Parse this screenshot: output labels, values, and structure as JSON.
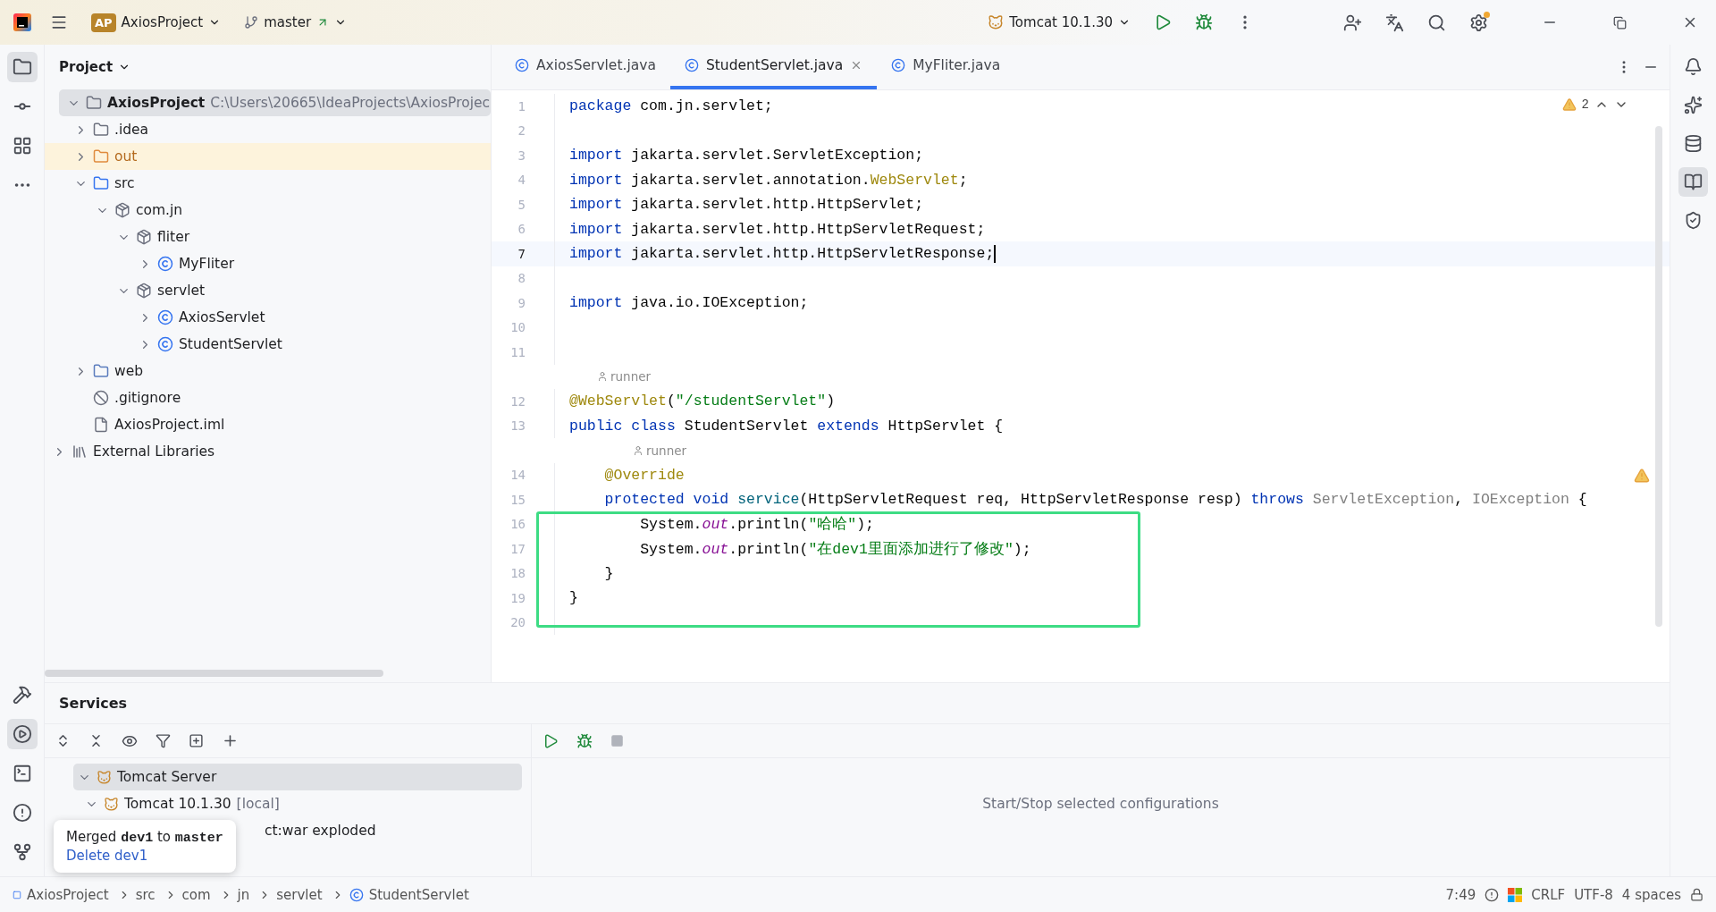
{
  "title_bar": {
    "project_badge": "AP",
    "project": "AxiosProject",
    "branch": "master",
    "run_config": "Tomcat 10.1.30"
  },
  "project_panel": {
    "title": "Project",
    "tree": [
      {
        "label": "AxiosProject",
        "kind": "project",
        "path": "C:\\Users\\20665\\IdeaProjects\\AxiosProjec",
        "expanded": true,
        "selected": true,
        "children": [
          {
            "label": ".idea",
            "kind": "folder",
            "expanded": false,
            "selected": false
          },
          {
            "label": "out",
            "kind": "excluded",
            "expanded": false,
            "selected": false
          },
          {
            "label": "src",
            "kind": "source",
            "expanded": true,
            "selected": false,
            "children": [
              {
                "label": "com.jn",
                "kind": "package",
                "expanded": true,
                "selected": false,
                "children": [
                  {
                    "label": "fliter",
                    "kind": "package",
                    "expanded": true,
                    "selected": false,
                    "children": [
                      {
                        "label": "MyFliter",
                        "kind": "class",
                        "expanded": false,
                        "selected": false
                      }
                    ]
                  },
                  {
                    "label": "servlet",
                    "kind": "package",
                    "expanded": true,
                    "selected": false,
                    "children": [
                      {
                        "label": "AxiosServlet",
                        "kind": "class",
                        "expanded": false,
                        "selected": false
                      },
                      {
                        "label": "StudentServlet",
                        "kind": "class",
                        "expanded": false,
                        "selected": false
                      }
                    ]
                  }
                ]
              }
            ]
          },
          {
            "label": "web",
            "kind": "web",
            "expanded": false,
            "selected": false
          },
          {
            "label": ".gitignore",
            "kind": "ignore",
            "selected": false
          },
          {
            "label": "AxiosProject.iml",
            "kind": "file",
            "selected": false
          }
        ]
      },
      {
        "label": "External Libraries",
        "kind": "library",
        "expanded": false,
        "selected": false
      }
    ]
  },
  "editor": {
    "tabs": [
      {
        "label": "AxiosServlet.java",
        "selected": false
      },
      {
        "label": "StudentServlet.java",
        "selected": true
      },
      {
        "label": "MyFliter.java",
        "selected": false
      }
    ],
    "warnings": "2",
    "lines": [
      {
        "kind": "code",
        "number": "1",
        "current": false,
        "tokens": [
          {
            "kind": "kw",
            "text": "package "
          },
          {
            "kind": "plain",
            "text": "com.jn.servlet;"
          }
        ]
      },
      {
        "kind": "code",
        "number": "2",
        "current": false
      },
      {
        "kind": "code",
        "number": "3",
        "current": false,
        "tokens": [
          {
            "kind": "kw",
            "text": "import "
          },
          {
            "kind": "plain",
            "text": "jakarta.servlet.ServletException;"
          }
        ]
      },
      {
        "kind": "code",
        "number": "4",
        "current": false,
        "tokens": [
          {
            "kind": "kw",
            "text": "import "
          },
          {
            "kind": "plain",
            "text": "jakarta.servlet.annotation."
          },
          {
            "kind": "ann",
            "text": "WebServlet"
          },
          {
            "kind": "plain",
            "text": ";"
          }
        ]
      },
      {
        "kind": "code",
        "number": "5",
        "current": false,
        "tokens": [
          {
            "kind": "kw",
            "text": "import "
          },
          {
            "kind": "plain",
            "text": "jakarta.servlet.http.HttpServlet;"
          }
        ]
      },
      {
        "kind": "code",
        "number": "6",
        "current": false,
        "tokens": [
          {
            "kind": "kw",
            "text": "import "
          },
          {
            "kind": "plain",
            "text": "jakarta.servlet.http.HttpServletRequest;"
          }
        ]
      },
      {
        "kind": "code",
        "number": "7",
        "current": true,
        "tokens": [
          {
            "kind": "kw",
            "text": "import "
          },
          {
            "kind": "plain",
            "text": "jakarta.servlet.http.HttpServletResponse;"
          }
        ]
      },
      {
        "kind": "code",
        "number": "8",
        "current": false
      },
      {
        "kind": "code",
        "number": "9",
        "current": false,
        "tokens": [
          {
            "kind": "kw",
            "text": "import "
          },
          {
            "kind": "plain",
            "text": "java.io.IOException;"
          }
        ]
      },
      {
        "kind": "code",
        "number": "10",
        "current": false
      },
      {
        "kind": "code",
        "number": "11",
        "current": false
      },
      {
        "kind": "hint",
        "text": "runner",
        "nested": false
      },
      {
        "kind": "code",
        "number": "12",
        "current": false,
        "tokens": [
          {
            "kind": "ann",
            "text": "@WebServlet"
          },
          {
            "kind": "plain",
            "text": "("
          },
          {
            "kind": "str",
            "text": "\"/studentServlet\""
          },
          {
            "kind": "plain",
            "text": ")"
          }
        ]
      },
      {
        "kind": "code",
        "number": "13",
        "current": false,
        "tokens": [
          {
            "kind": "kw",
            "text": "public class "
          },
          {
            "kind": "plain",
            "text": "StudentServlet "
          },
          {
            "kind": "kw",
            "text": "extends "
          },
          {
            "kind": "plain",
            "text": "HttpServlet {"
          }
        ]
      },
      {
        "kind": "hint",
        "text": "runner",
        "nested": true
      },
      {
        "kind": "code",
        "number": "14",
        "current": false,
        "tokens": [
          {
            "kind": "ann",
            "text": "    @Override"
          }
        ]
      },
      {
        "kind": "code",
        "number": "15",
        "current": false,
        "tokens": [
          {
            "kind": "kw",
            "text": "    protected void "
          },
          {
            "kind": "method",
            "text": "service"
          },
          {
            "kind": "plain",
            "text": "(HttpServletRequest req, HttpServletResponse resp) "
          },
          {
            "kind": "kw",
            "text": "throws "
          },
          {
            "kind": "muted",
            "text": "ServletException"
          },
          {
            "kind": "plain",
            "text": ", "
          },
          {
            "kind": "muted",
            "text": "IOException"
          },
          {
            "kind": "plain",
            "text": " {"
          }
        ]
      },
      {
        "kind": "code",
        "number": "16",
        "current": false,
        "tokens": [
          {
            "kind": "plain",
            "text": "        System."
          },
          {
            "kind": "static",
            "text": "out"
          },
          {
            "kind": "plain",
            "text": ".println("
          },
          {
            "kind": "str",
            "text": "\"哈哈\""
          },
          {
            "kind": "plain",
            "text": ");"
          }
        ]
      },
      {
        "kind": "code",
        "number": "17",
        "current": false,
        "tokens": [
          {
            "kind": "plain",
            "text": "        System."
          },
          {
            "kind": "static",
            "text": "out"
          },
          {
            "kind": "plain",
            "text": ".println("
          },
          {
            "kind": "str",
            "text": "\"在dev1里面添加进行了修改\""
          },
          {
            "kind": "plain",
            "text": ");"
          }
        ]
      },
      {
        "kind": "code",
        "number": "18",
        "current": false,
        "tokens": [
          {
            "kind": "plain",
            "text": "    }"
          }
        ]
      },
      {
        "kind": "code",
        "number": "19",
        "current": false,
        "tokens": [
          {
            "kind": "plain",
            "text": "}"
          }
        ]
      },
      {
        "kind": "code",
        "number": "20",
        "current": false
      }
    ]
  },
  "services": {
    "title": "Services",
    "tree": [
      {
        "label": "Tomcat Server",
        "expanded": true,
        "selected": true,
        "children": [
          {
            "label": "Tomcat 10.1.30",
            "suffix": "[local]",
            "expanded": true,
            "selected": false,
            "children": [
              {
                "label": "ct:war exploded",
                "selected": false
              }
            ]
          }
        ]
      }
    ],
    "hint": "Start/Stop selected configurations"
  },
  "notification": {
    "text": "Merged **dev1** to **master**",
    "link": "Delete dev1"
  },
  "status_bar": {
    "breadcrumbs": [
      "AxiosProject",
      "src",
      "com",
      "jn",
      "servlet",
      "StudentServlet"
    ],
    "position": "7:49",
    "line_separator": "CRLF",
    "encoding": "UTF-8",
    "indent": "4 spaces"
  }
}
